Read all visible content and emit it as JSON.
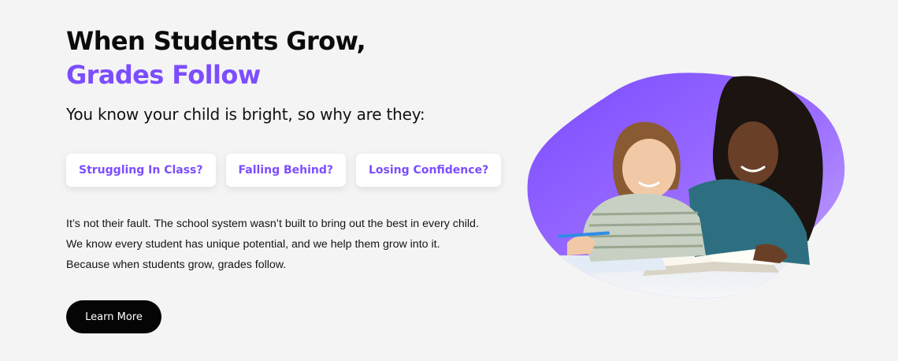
{
  "hero": {
    "title_line1": "When Students Grow,",
    "title_line2": "Grades Follow",
    "subtitle": "You know your child is bright, so why are they:",
    "chips": [
      "Struggling In Class?",
      "Falling Behind?",
      "Losing Confidence?"
    ],
    "body": [
      "It’s not their fault. The school system wasn’t built to bring out the best in every child.",
      "We know every student has unique potential, and we help them grow into it.",
      "Because when students grow, grades follow."
    ],
    "cta_label": "Learn More"
  },
  "colors": {
    "accent": "#7c4dff",
    "background": "#f4f4f4",
    "cta_background": "#050505"
  }
}
